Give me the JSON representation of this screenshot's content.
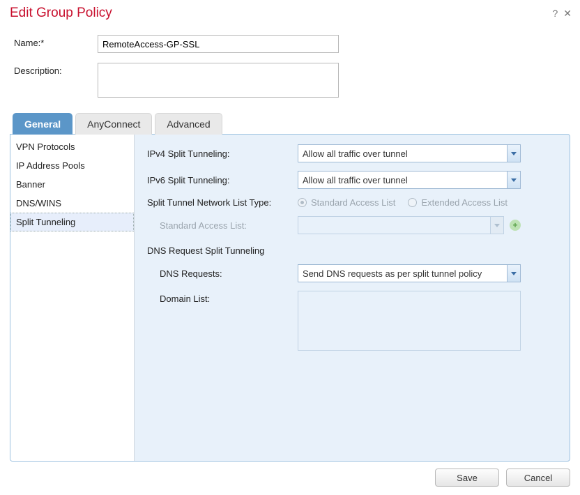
{
  "title": "Edit Group Policy",
  "labels": {
    "name": "Name:*",
    "description": "Description:"
  },
  "fields": {
    "name_value": "RemoteAccess-GP-SSL",
    "description_value": ""
  },
  "tabs": [
    "General",
    "AnyConnect",
    "Advanced"
  ],
  "active_tab": "General",
  "side_nav": [
    "VPN Protocols",
    "IP Address Pools",
    "Banner",
    "DNS/WINS",
    "Split Tunneling"
  ],
  "side_selected": "Split Tunneling",
  "content": {
    "ipv4_label": "IPv4 Split Tunneling:",
    "ipv4_value": "Allow all traffic over tunnel",
    "ipv6_label": "IPv6 Split Tunneling:",
    "ipv6_value": "Allow all traffic over tunnel",
    "list_type_label": "Split Tunnel Network List Type:",
    "radio_standard": "Standard Access List",
    "radio_extended": "Extended Access List",
    "std_list_label": "Standard Access List:",
    "std_list_value": "",
    "dns_section": "DNS Request Split Tunneling",
    "dns_requests_label": "DNS Requests:",
    "dns_requests_value": "Send DNS requests as per split tunnel policy",
    "domain_list_label": "Domain List:"
  },
  "footer": {
    "save": "Save",
    "cancel": "Cancel"
  }
}
